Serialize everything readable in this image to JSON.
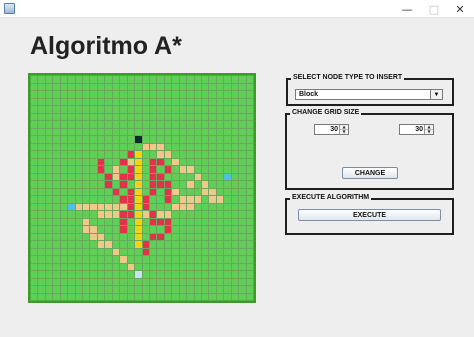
{
  "window": {
    "minimize_glyph": "—",
    "maximize_glyph": "□",
    "close_glyph": "✕"
  },
  "title": "Algoritmo A*",
  "panels": {
    "node_type": {
      "legend": "SELECT NODE TYPE TO INSERT",
      "selected": "Block",
      "arrow_glyph": "▼"
    },
    "grid_size": {
      "legend": "CHANGE GRID SIZE",
      "rows": "30",
      "cols": "30",
      "up_glyph": "▲",
      "down_glyph": "▼",
      "button": "CHANGE"
    },
    "execute": {
      "legend": "EXECUTE ALGORITHM",
      "button": "EXECUTE"
    }
  },
  "grid": {
    "rows": 30,
    "cols": 30,
    "colors": {
      "empty": "#5fcf55",
      "path": "#f0c98a",
      "yellow": "#f5d312",
      "block": "#e3334a",
      "start": "#0b2a2a",
      "endpoint": "#4fc1de",
      "goal": "#c5e2ee"
    },
    "cells": {
      "start": [
        [
          8,
          14
        ]
      ],
      "goal": [
        [
          26,
          14
        ]
      ],
      "endpoint": [
        [
          13,
          26
        ],
        [
          17,
          5
        ]
      ],
      "yellow": [
        [
          10,
          14
        ],
        [
          11,
          14
        ],
        [
          12,
          14
        ],
        [
          13,
          14
        ],
        [
          14,
          14
        ],
        [
          15,
          14
        ],
        [
          16,
          14
        ],
        [
          17,
          14
        ],
        [
          18,
          14
        ],
        [
          19,
          14
        ],
        [
          20,
          14
        ],
        [
          21,
          14
        ],
        [
          22,
          14
        ]
      ],
      "block": [
        [
          11,
          9
        ],
        [
          12,
          9
        ],
        [
          13,
          10
        ],
        [
          14,
          10
        ],
        [
          15,
          11
        ],
        [
          16,
          12
        ],
        [
          11,
          12
        ],
        [
          13,
          12
        ],
        [
          14,
          12
        ],
        [
          13,
          13
        ],
        [
          15,
          13
        ],
        [
          10,
          13
        ],
        [
          12,
          13
        ],
        [
          16,
          13
        ],
        [
          18,
          12
        ],
        [
          19,
          12
        ],
        [
          17,
          13
        ],
        [
          20,
          12
        ],
        [
          18,
          13
        ],
        [
          11,
          16
        ],
        [
          12,
          16
        ],
        [
          13,
          16
        ],
        [
          11,
          17
        ],
        [
          13,
          17
        ],
        [
          12,
          18
        ],
        [
          14,
          16
        ],
        [
          14,
          17
        ],
        [
          16,
          15
        ],
        [
          17,
          15
        ],
        [
          15,
          16
        ],
        [
          18,
          16
        ],
        [
          19,
          16
        ],
        [
          14,
          18
        ],
        [
          15,
          18
        ],
        [
          16,
          18
        ],
        [
          19,
          17
        ],
        [
          19,
          18
        ],
        [
          20,
          18
        ],
        [
          21,
          16
        ],
        [
          21,
          17
        ],
        [
          22,
          15
        ],
        [
          23,
          15
        ]
      ],
      "path": [
        [
          9,
          15
        ],
        [
          9,
          16
        ],
        [
          9,
          17
        ],
        [
          10,
          17
        ],
        [
          10,
          18
        ],
        [
          11,
          19
        ],
        [
          12,
          20
        ],
        [
          12,
          21
        ],
        [
          13,
          22
        ],
        [
          14,
          23
        ],
        [
          15,
          24
        ],
        [
          16,
          24
        ],
        [
          16,
          25
        ],
        [
          16,
          22
        ],
        [
          15,
          23
        ],
        [
          17,
          21
        ],
        [
          17,
          20
        ],
        [
          16,
          21
        ],
        [
          17,
          19
        ],
        [
          18,
          18
        ],
        [
          18,
          17
        ],
        [
          16,
          20
        ],
        [
          15,
          19
        ],
        [
          14,
          21
        ],
        [
          17,
          6
        ],
        [
          17,
          7
        ],
        [
          17,
          8
        ],
        [
          17,
          9
        ],
        [
          18,
          9
        ],
        [
          18,
          10
        ],
        [
          18,
          11
        ],
        [
          18,
          12
        ],
        [
          17,
          13
        ],
        [
          17,
          14
        ],
        [
          18,
          14
        ],
        [
          18,
          15
        ],
        [
          18,
          16
        ],
        [
          19,
          17
        ],
        [
          19,
          18
        ],
        [
          19,
          7
        ],
        [
          20,
          7
        ],
        [
          20,
          8
        ],
        [
          21,
          8
        ],
        [
          21,
          9
        ],
        [
          22,
          9
        ],
        [
          22,
          10
        ],
        [
          23,
          11
        ],
        [
          24,
          12
        ],
        [
          25,
          13
        ],
        [
          17,
          10
        ],
        [
          17,
          11
        ],
        [
          17,
          12
        ],
        [
          13,
          11
        ],
        [
          12,
          11
        ],
        [
          11,
          13
        ]
      ]
    }
  }
}
